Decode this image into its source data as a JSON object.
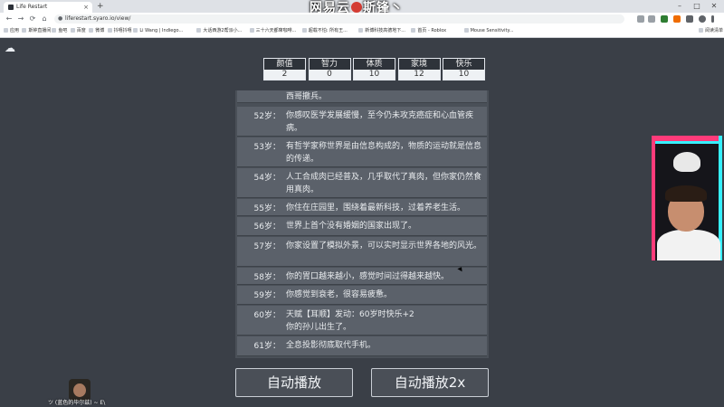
{
  "browser": {
    "tab_title": "Life Restart",
    "tab_close": "×",
    "new_tab": "+",
    "url": "liferestart.syaro.io/view/",
    "nav": {
      "back": "←",
      "forward": "→",
      "reload": "⟳",
      "home": "⌂"
    },
    "bookmarks": [
      "应用",
      "斯钟直播间",
      "鱼吧",
      "百度",
      "微博",
      "抖嘻抖嘻",
      "Li Wang | Indiego...",
      "大话西游2帮派小...",
      "三十六天都窜咖啡...",
      "超载不怕: 所有王...",
      "新博科技高德地下...",
      "首页 - Roblox",
      "Mouse Sensitivity...",
      "阅读清单"
    ],
    "window_controls": {
      "minimize": "–",
      "maximize": "□",
      "close": "✕"
    }
  },
  "watermark": {
    "left": "网易云",
    "right": "斯锋丶"
  },
  "stats": [
    {
      "label": "颜值",
      "value": "2"
    },
    {
      "label": "智力",
      "value": "0"
    },
    {
      "label": "体质",
      "value": "10"
    },
    {
      "label": "家境",
      "value": "12"
    },
    {
      "label": "快乐",
      "value": "10"
    }
  ],
  "log": [
    {
      "age": "",
      "text": "西哥撤兵。"
    },
    {
      "age": "52岁：",
      "text": "你感叹医学发展缓慢，至今仍未攻克癌症和心血管疾病。"
    },
    {
      "age": "53岁：",
      "text": "有哲学家称世界是由信息构成的，物质的运动就是信息的传递。"
    },
    {
      "age": "54岁：",
      "text": "人工合成肉已经普及，几乎取代了真肉，但你家仍然食用真肉。"
    },
    {
      "age": "55岁：",
      "text": "你住在庄园里，围绕着最新科技，过着养老生活。"
    },
    {
      "age": "56岁：",
      "text": "世界上首个没有婚姻的国家出现了。"
    },
    {
      "age": "57岁：",
      "text": "你家设置了模拟外景，可以实时显示世界各地的风光。"
    },
    {
      "age": "58岁：",
      "text": "你的胃口越来越小，感觉时间过得越来越快。"
    },
    {
      "age": "59岁：",
      "text": "你感觉到衰老，很容易疲惫。"
    },
    {
      "age": "60岁：",
      "text": "天赋【耳顺】发动：60岁时快乐+2\n你的孙儿出生了。"
    },
    {
      "age": "61岁：",
      "text": "全息投影彻底取代手机。"
    }
  ],
  "buttons": {
    "auto_play": "自动播放",
    "auto_play_2x": "自动播放2x"
  },
  "streamer": {
    "label": "ツ (蓝色的毕尔兹) ~ E\\"
  },
  "colors": {
    "page_bg": "#3a3f47",
    "log_item": "#5b616a",
    "stat_header": "#2e333a"
  }
}
